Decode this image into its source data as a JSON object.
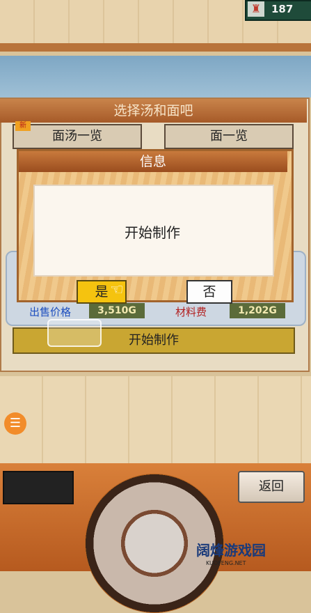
{
  "hud": {
    "coins": "187"
  },
  "panel": {
    "title": "选择汤和面吧",
    "tabs": [
      "面汤一览",
      "面一览"
    ],
    "new_badge": "新",
    "sell_label": "出售价格",
    "sell_value": "3,510G",
    "cost_label": "材料费",
    "cost_value": "1,202G",
    "start_label": "开始制作"
  },
  "dialog": {
    "title": "信息",
    "message": "开始制作",
    "yes": "是",
    "no": "否"
  },
  "controls": {
    "back": "返回"
  },
  "watermark": {
    "logo": "阔烽游戏园",
    "sub": "KUOFENG.NET"
  }
}
